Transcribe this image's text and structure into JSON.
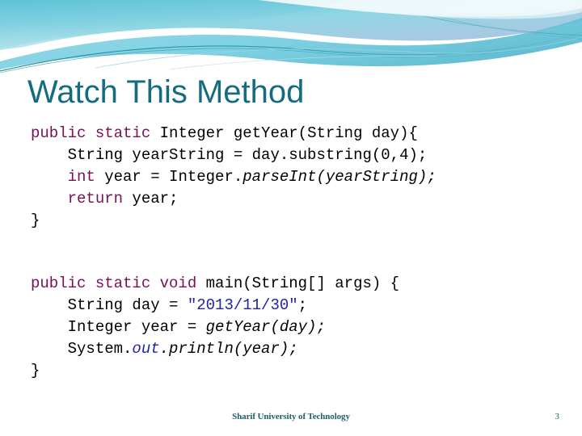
{
  "slide": {
    "title": "Watch This Method",
    "page_number": "3",
    "footer": "Sharif University of Technology",
    "theme": {
      "title_color": "#156C80",
      "footer_color": "#1F5E6B",
      "banner_top_color": "#6FC7DB",
      "banner_mid_color": "#A9DCE8",
      "banner_accent_color": "#2E8FA3",
      "keyword_color": "#7A1054",
      "string_color": "#2222A8",
      "code_color": "#000000",
      "background_color": "#FFFFFF"
    }
  },
  "code_block_1": {
    "lines": [
      [
        {
          "text": "public static ",
          "style": "kw"
        },
        {
          "text": "Integer getYear(String day){",
          "style": "plain"
        }
      ],
      [
        {
          "text": "    String yearString = day.substring(0,4);",
          "style": "plain"
        }
      ],
      [
        {
          "text": "    int",
          "style": "kw"
        },
        {
          "text": " year = Integer.",
          "style": "plain"
        },
        {
          "text": "parseInt(yearString);",
          "style": "italic"
        }
      ],
      [
        {
          "text": "    return",
          "style": "kw"
        },
        {
          "text": " year;",
          "style": "plain"
        }
      ],
      [
        {
          "text": "}",
          "style": "plain"
        }
      ]
    ]
  },
  "code_block_2": {
    "lines": [
      [
        {
          "text": "public static void ",
          "style": "kw"
        },
        {
          "text": "main(String[] args) {",
          "style": "plain"
        }
      ],
      [
        {
          "text": "    String day = ",
          "style": "plain"
        },
        {
          "text": "\"2013/11/30\"",
          "style": "string"
        },
        {
          "text": ";",
          "style": "plain"
        }
      ],
      [
        {
          "text": "    Integer year = ",
          "style": "plain"
        },
        {
          "text": "getYear(day);",
          "style": "italic"
        }
      ],
      [
        {
          "text": "    System.",
          "style": "plain"
        },
        {
          "text": "out",
          "style": "field"
        },
        {
          "text": ".println(year);",
          "style": "italic"
        }
      ],
      [
        {
          "text": "}",
          "style": "plain"
        }
      ]
    ]
  }
}
